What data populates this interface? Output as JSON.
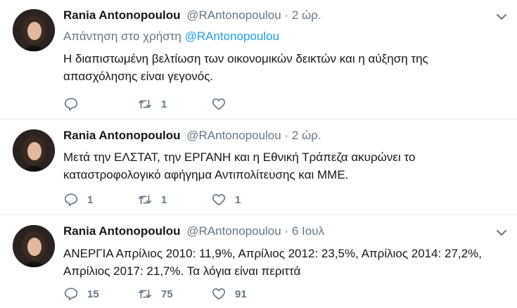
{
  "tweets": [
    {
      "name": "Rania Antonopoulou",
      "handle": "@RAntonopoulou",
      "separator": "·",
      "time": "2 ώρ.",
      "reply_prefix": "Απάντηση στο χρήστη",
      "reply_mention": "@RAntonopoulou",
      "text": "Η διαπιστωμένη βελτίωση των οικονομικών δεικτών και η αύξηση της απασχόλησης είναι γεγονός.",
      "replies": "",
      "retweets": "1",
      "likes": ""
    },
    {
      "name": "Rania Antonopoulou",
      "handle": "@RAntonopoulou",
      "separator": "·",
      "time": "2 ώρ.",
      "text": "Μετά την ΕΛΣΤΑΤ, την ΕΡΓΑΝΗ και η Εθνική Τράπεζα  ακυρώνει το καταστροφολογικό αφήγημα Αντιπολίτευσης και ΜΜΕ.",
      "replies": "1",
      "retweets": "1",
      "likes": "1"
    },
    {
      "name": "Rania Antonopoulou",
      "handle": "@RAntonopoulou",
      "separator": "·",
      "time": "6 Ιουλ",
      "text": "ΑΝΕΡΓΙΑ Απρίλιος 2010: 11,9%, Απρίλιος 2012: 23,5%, Απρίλιος 2014: 27,2%, Απρίλιος 2017: 21,7%. Τα λόγια είναι περιττά",
      "replies": "15",
      "retweets": "75",
      "likes": "91"
    }
  ],
  "colors": {
    "accent": "#1da1f2",
    "muted": "#657786",
    "text": "#14171a",
    "divider": "#e6ecf0"
  },
  "icons": {
    "reply": "reply-icon",
    "retweet": "retweet-icon",
    "like": "heart-icon",
    "menu": "chevron-down-icon"
  }
}
